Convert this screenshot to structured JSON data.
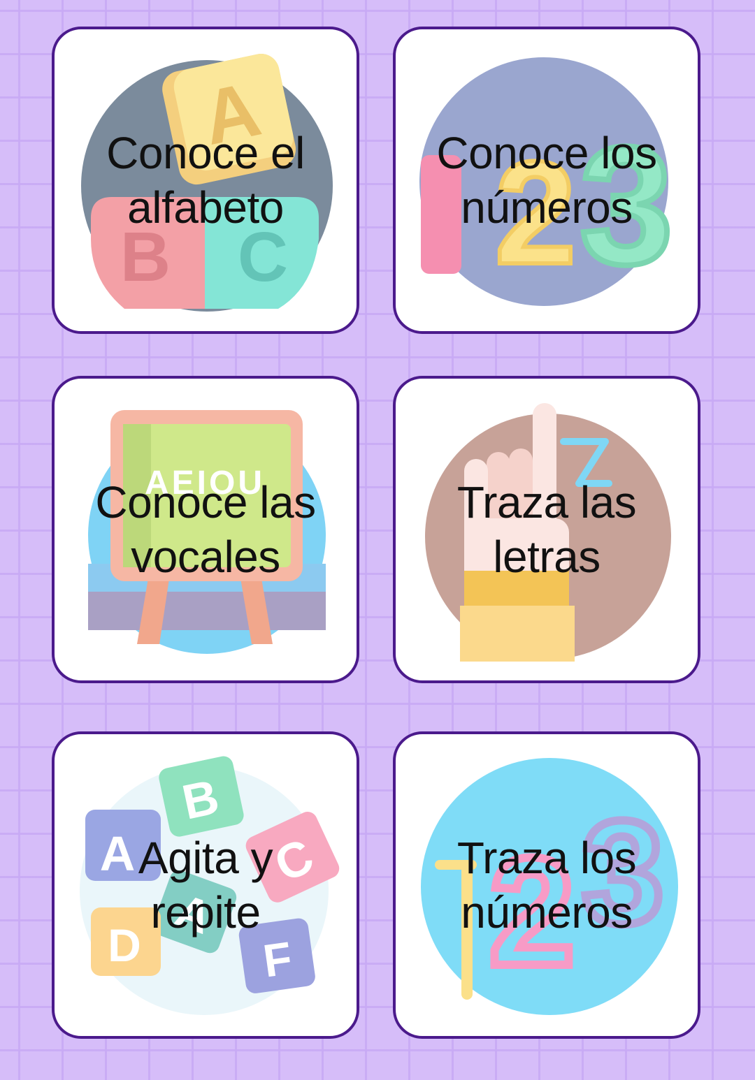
{
  "cards": [
    {
      "label": "Conoce el\nalfabeto",
      "icon": "alphabet-blocks-icon"
    },
    {
      "label": "Conoce los\nnúmeros",
      "icon": "numbers-123-icon"
    },
    {
      "label": "Conoce las\nvocales",
      "icon": "vowels-chalkboard-icon"
    },
    {
      "label": "Traza las\nletras",
      "icon": "finger-trace-icon"
    },
    {
      "label": "Agita y\nrepite",
      "icon": "scattered-letter-blocks-icon"
    },
    {
      "label": "Traza los\nnúmeros",
      "icon": "numbers-trace-icon"
    }
  ],
  "colors": {
    "background": "#d6bdf9",
    "card_border": "#4b1a8c",
    "card_fill": "#ffffff",
    "text": "#111111"
  }
}
